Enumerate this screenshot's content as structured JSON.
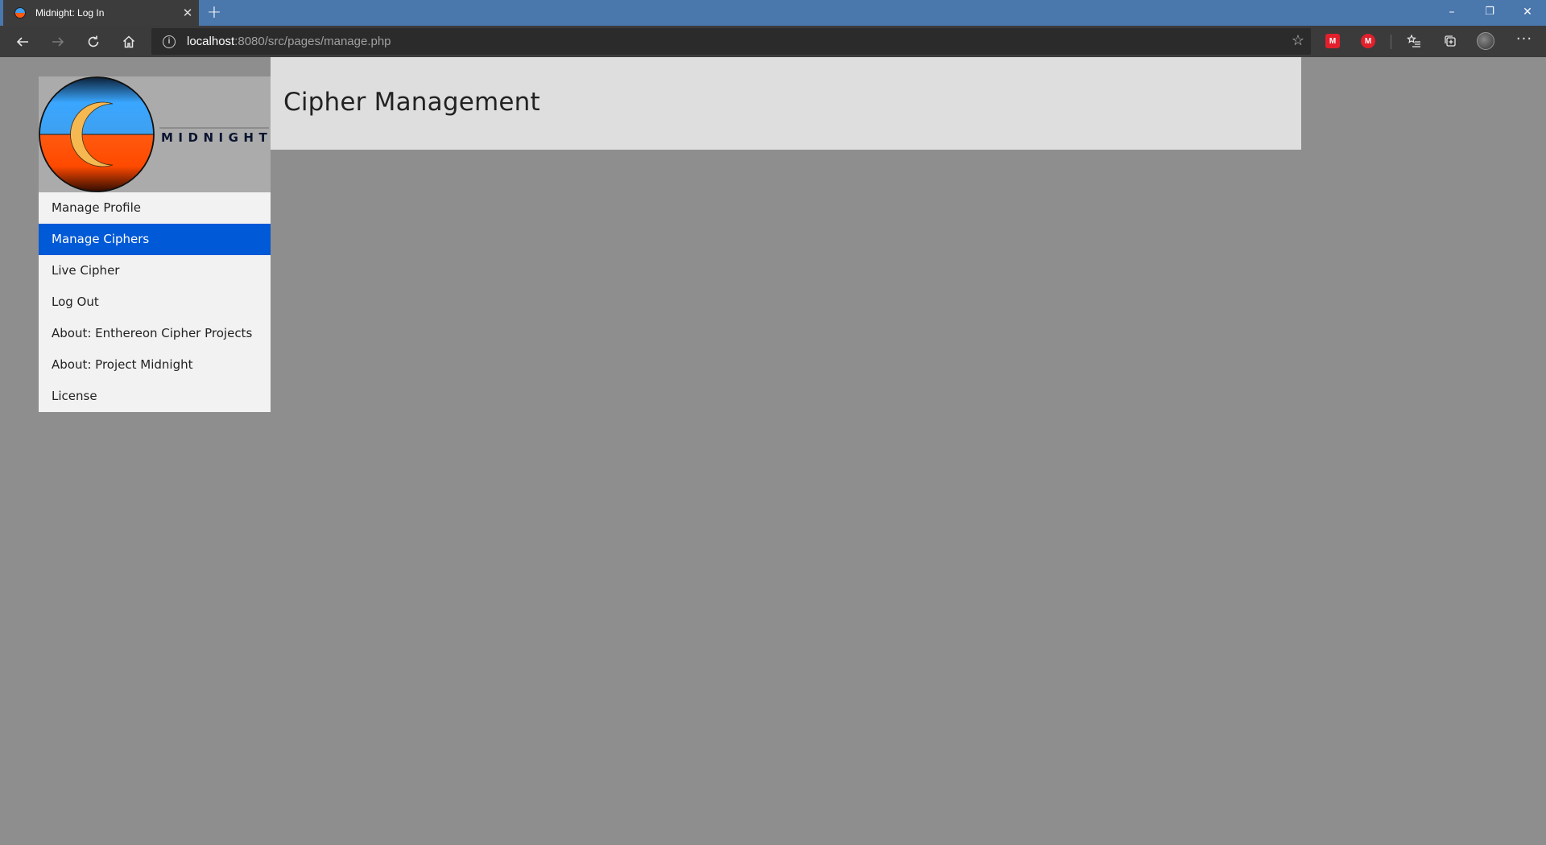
{
  "browser": {
    "tab_title": "Midnight: Log In",
    "tab_close": "✕",
    "new_tab": "+",
    "url_host": "localhost",
    "url_path": ":8080/src/pages/manage.php",
    "info_glyph": "i",
    "star_glyph": "☆",
    "more_glyph": "···",
    "window_controls": {
      "minimize": "–",
      "restore": "❐",
      "close": "✕"
    },
    "extension_1_label": "M",
    "extension_2_label": "M",
    "icons": [
      "back-arrow-icon",
      "forward-arrow-icon",
      "refresh-icon",
      "home-icon",
      "info-icon",
      "star-icon",
      "favorites-icon",
      "collections-icon",
      "profile-icon",
      "more-icon"
    ],
    "colors": {
      "titlebar": "#4a77ac",
      "tab": "#3c3c3c",
      "navbar": "#3b3b3b",
      "extension_red": "#e2202c"
    }
  },
  "logo": {
    "wordmark": "MIDNIGHT",
    "colors": {
      "sky": "#3ea0f0",
      "sea": "#ff5a10",
      "moon": "#f6b850"
    }
  },
  "sidebar": {
    "items": [
      {
        "label": "Manage Profile",
        "active": false
      },
      {
        "label": "Manage Ciphers",
        "active": true
      },
      {
        "label": "Live Cipher",
        "active": false
      },
      {
        "label": "Log Out",
        "active": false
      },
      {
        "label": "About: Enthereon Cipher Projects",
        "active": false
      },
      {
        "label": "About: Project Midnight",
        "active": false
      },
      {
        "label": "License",
        "active": false
      }
    ],
    "active_color": "#0059d6"
  },
  "header": {
    "title": "Cipher Management"
  }
}
